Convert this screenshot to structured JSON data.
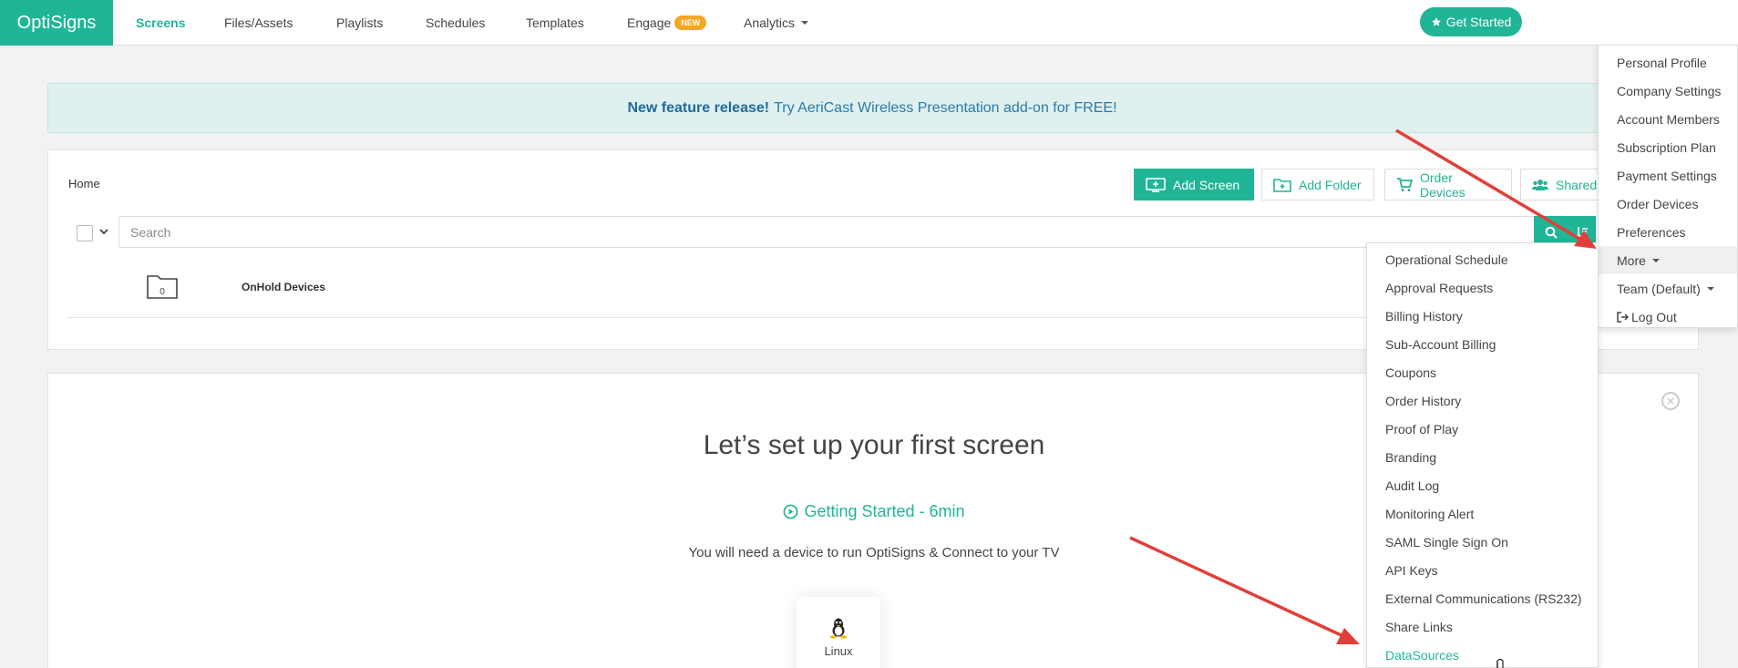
{
  "nav": {
    "brand": "OptiSigns",
    "items": [
      "Screens",
      "Files/Assets",
      "Playlists",
      "Schedules",
      "Templates"
    ],
    "engage": "Engage",
    "engage_badge": "NEW",
    "analytics": "Analytics",
    "get_started": "Get Started"
  },
  "banner": {
    "bold": "New feature release!",
    "text": "Try AeriCast Wireless Presentation add-on for FREE!"
  },
  "screens": {
    "breadcrumb": "Home",
    "buttons": {
      "add_screen": "Add Screen",
      "add_folder": "Add Folder",
      "order_devices": "Order Devices",
      "shared": "Shared"
    },
    "search_placeholder": "Search",
    "folder": {
      "count": "0",
      "name": "OnHold Devices"
    }
  },
  "setup": {
    "title": "Let’s set up your first screen",
    "link": "Getting Started - 6min",
    "desc": "You will need a device to run OptiSigns & Connect to your TV",
    "os": "Linux"
  },
  "user_menu": {
    "items": [
      "Personal Profile",
      "Company Settings",
      "Account Members",
      "Subscription Plan",
      "Payment Settings",
      "Order Devices",
      "Preferences",
      "More",
      "Team (Default)",
      "Log Out"
    ]
  },
  "more_menu": {
    "items": [
      "Operational Schedule",
      "Approval Requests",
      "Billing History",
      "Sub-Account Billing",
      "Coupons",
      "Order History",
      "Proof of Play",
      "Branding",
      "Audit Log",
      "Monitoring Alert",
      "SAML Single Sign On",
      "API Keys",
      "External Communications (RS232)",
      "Share Links",
      "DataSources"
    ]
  },
  "colors": {
    "brand": "#20b596",
    "badge": "#f5a623",
    "annotation_arrow": "#e0403a"
  }
}
